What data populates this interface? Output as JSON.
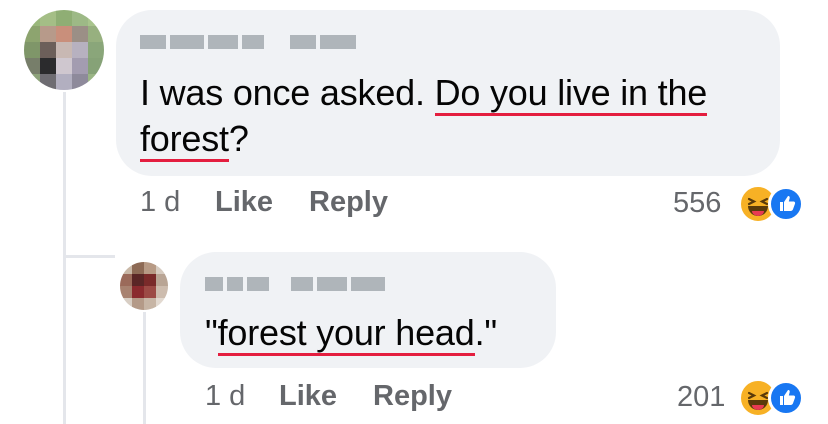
{
  "comment": {
    "text_part1": "I was once asked. ",
    "text_underlined_1": "Do you live in the",
    "text_underlined_2": "forest",
    "text_tail": "?",
    "time": "1 d",
    "like_label": "Like",
    "reply_label": "Reply",
    "reaction_count": "556",
    "reactions": [
      "haha-icon",
      "like-icon"
    ]
  },
  "reply": {
    "text_open_quote": "\"",
    "text_underlined": "forest your head",
    "text_tail": ".\"",
    "time": "1 d",
    "like_label": "Like",
    "reply_label": "Reply",
    "reaction_count": "201",
    "reactions": [
      "haha-icon",
      "like-icon"
    ]
  },
  "colors": {
    "bubble": "#f0f2f5",
    "meta_text": "#65676b",
    "underline": "#e41e3f",
    "like_blue": "#1877f2",
    "haha_yellow": "#f7b125"
  }
}
